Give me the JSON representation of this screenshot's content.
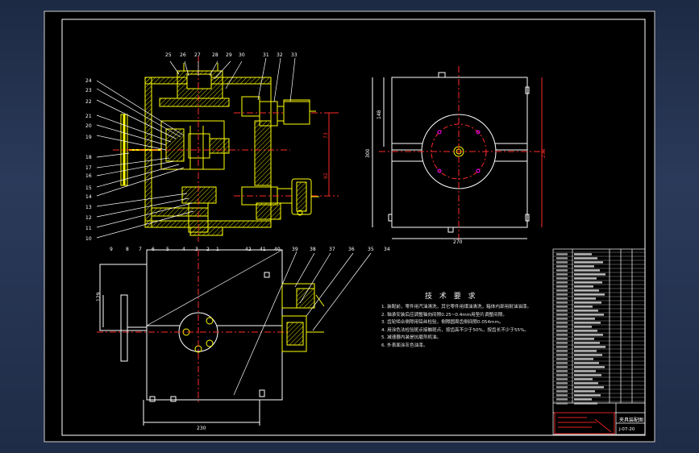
{
  "colors": {
    "frame_bg": "#000000",
    "border": "#ffffff",
    "part_outline": "#ffff00",
    "hatch": "#ffff00",
    "center_lines": "#ff2a2a",
    "leader_lines": "#ffffff",
    "dimensions": "#ffffff",
    "title_block_red": "#e02020"
  },
  "icons": [
    "pressure-gauge-icon",
    "hand-wheel-icon",
    "cylinder-icon"
  ],
  "balloons": {
    "top": [
      "25",
      "26",
      "27",
      "28",
      "29",
      "30",
      "31",
      "32",
      "33"
    ],
    "left": [
      "24",
      "23",
      "22",
      "21",
      "20",
      "19",
      "18",
      "17",
      "16",
      "15",
      "14",
      "13",
      "12",
      "11",
      "10"
    ],
    "bottom": [
      "9",
      "8",
      "7",
      "6",
      "5",
      "4",
      "3",
      "2",
      "1",
      "42",
      "41",
      "40"
    ],
    "lower": [
      "39",
      "38",
      "37",
      "36",
      "35",
      "34"
    ]
  },
  "dimensions": {
    "front": [
      "73",
      "92"
    ],
    "right_view": [
      "148",
      "300",
      "270",
      "238"
    ],
    "bottom_view": [
      "129",
      "230"
    ]
  },
  "tech_requirements": {
    "title": "技 术 要 求",
    "items": [
      "1. 装配前，零件用汽油清洗，其它零件用煤油清洗，箱体内部用耐油油漆。",
      "2. 轴承安装后应调整轴向间隙0.25~0.4mm用垫片调整间隙。",
      "3. 齿轮啮合侧隙用铅丝检验，侧隙圆周齿侧间隙0.054mm。",
      "4. 用涂色法检验斑点接触斑点，按齿高不少于50%，按齿长不少于55%。",
      "5. 减速器内装是抗磨剂机油。",
      "6. 外表面涂灰色油漆。"
    ]
  },
  "title_block": {
    "drawing_name": "夹具装配图",
    "drawing_code": "J-07-20"
  }
}
